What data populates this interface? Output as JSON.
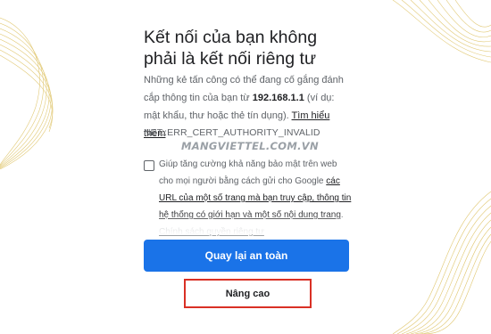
{
  "interstitial": {
    "title": "Kết nối của bạn không phải là kết nối riêng tư",
    "desc_before": "Những kẻ tấn công có thể đang cố gắng đánh cắp thông tin của bạn từ ",
    "host": "192.168.1.1",
    "desc_after": " (ví dụ: mật khẩu, thư hoặc thẻ tín dụng). ",
    "learn_more": "Tìm hiểu thêm",
    "error_code": "NET::ERR_CERT_AUTHORITY_INVALID",
    "watermark": "MANGVIETTEL.COM.VN",
    "optin_text": "Giúp tăng cường khả năng bảo mật trên web cho mọi người bằng cách gửi cho Google ",
    "optin_link": "các URL của một số trang mà bạn truy cập, thông tin hệ thống có giới hạn và một số nội dung trang",
    "optin_end": ".",
    "privacy_link": "Chính sách quyền riêng tư",
    "checkbox_checked": false,
    "back_button": "Quay lại an toàn",
    "advanced_button": "Nâng cao"
  },
  "colors": {
    "primary_button": "#1a73e8",
    "highlight_border": "#d93025",
    "decoration_gold": "#d8b84a"
  }
}
